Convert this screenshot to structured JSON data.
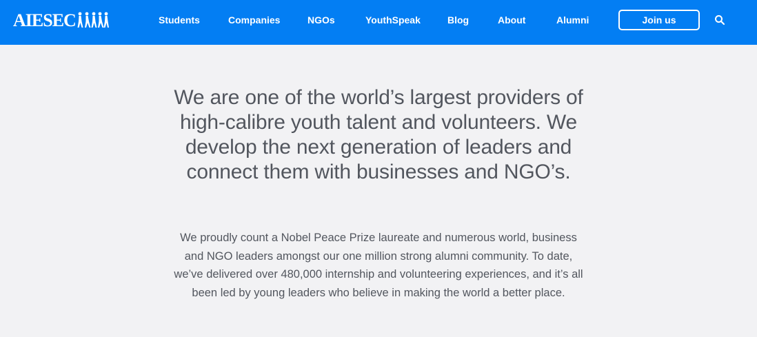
{
  "brand": {
    "logo_text": "AIESEC",
    "primary_color": "#037ef3",
    "background_color": "#f2f2f4",
    "text_color": "#52565e"
  },
  "nav": {
    "items": [
      {
        "label": "Students"
      },
      {
        "label": "Companies"
      },
      {
        "label": "NGOs"
      },
      {
        "label": "YouthSpeak"
      },
      {
        "label": "Blog"
      },
      {
        "label": "About"
      },
      {
        "label": "Alumni"
      }
    ],
    "join_label": "Join us",
    "search_icon": "search-icon"
  },
  "hero": {
    "headline": "We are one of the world’s largest providers of high-calibre youth talent and volunteers. We develop the next generation of leaders and connect them with businesses and NGO’s.",
    "body": "We proudly count a Nobel Peace Prize laureate and numerous world, business and NGO leaders amongst our one million strong alumni community. To date, we’ve delivered over 480,000 internship and volunteering experiences, and it’s all been led by young leaders who believe in making the world a better place."
  }
}
